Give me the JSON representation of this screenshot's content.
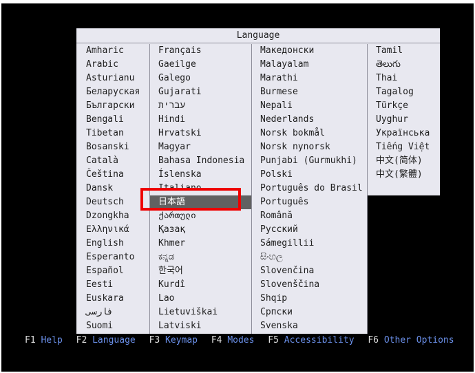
{
  "title": "Language",
  "columns": [
    [
      "Amharic",
      "Arabic",
      "Asturianu",
      "Беларуская",
      "Български",
      "Bengali",
      "Tibetan",
      "Bosanski",
      "Català",
      "Čeština",
      "Dansk",
      "Deutsch",
      "Dzongkha",
      "Ελληνικά",
      "English",
      "Esperanto",
      "Español",
      "Eesti",
      "Euskara",
      "فارسی",
      "Suomi"
    ],
    [
      "Français",
      "Gaeilge",
      "Galego",
      "Gujarati",
      "עברית",
      "Hindi",
      "Hrvatski",
      "Magyar",
      "Bahasa Indonesia",
      "Íslenska",
      "Italiano",
      "日本語",
      "ქართული",
      "Қазақ",
      "Khmer",
      "ಕನ್ನಡ",
      "한국어",
      "Kurdî",
      "Lao",
      "Lietuviškai",
      "Latviski"
    ],
    [
      "Македонски",
      "Malayalam",
      "Marathi",
      "Burmese",
      "Nepali",
      "Nederlands",
      "Norsk bokmål",
      "Norsk nynorsk",
      "Punjabi (Gurmukhi)",
      "Polski",
      "Português do Brasil",
      "Português",
      "Română",
      "Русский",
      "Sámegillii",
      "සිංහල",
      "Slovenčina",
      "Slovenščina",
      "Shqip",
      "Српски",
      "Svenska"
    ],
    [
      "Tamil",
      "తెలుగు",
      "Thai",
      "Tagalog",
      "Türkçe",
      "Uyghur",
      "Українська",
      "Tiếng Việt",
      "中文(简体)",
      "中文(繁體)"
    ]
  ],
  "selected": "日本語",
  "function_keys": [
    {
      "key": "F1",
      "label": "Help"
    },
    {
      "key": "F2",
      "label": "Language"
    },
    {
      "key": "F3",
      "label": "Keymap"
    },
    {
      "key": "F4",
      "label": "Modes"
    },
    {
      "key": "F5",
      "label": "Accessibility"
    },
    {
      "key": "F6",
      "label": "Other Options"
    }
  ],
  "colors": {
    "background": "#000000",
    "dialog": "#e8e8f0",
    "selected": "#616161",
    "highlight_box": "#ee0000",
    "fkey_label": "#6a8fe8"
  }
}
